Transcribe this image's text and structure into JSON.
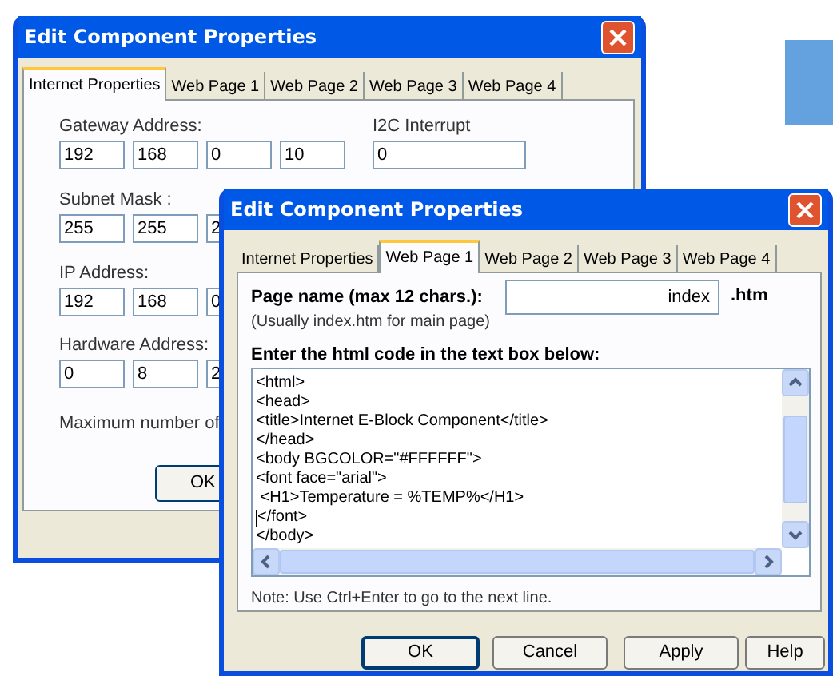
{
  "back_window": {
    "title": "Edit Component Properties",
    "tabs": [
      {
        "label": "Internet Properties",
        "selected": true
      },
      {
        "label": "Web Page 1",
        "selected": false
      },
      {
        "label": "Web Page 2",
        "selected": false
      },
      {
        "label": "Web Page 3",
        "selected": false
      },
      {
        "label": "Web Page 4",
        "selected": false
      }
    ],
    "address_groups": [
      {
        "label": "Gateway Address:",
        "values": [
          "192",
          "168",
          "0",
          "10"
        ]
      },
      {
        "label": "Subnet Mask :",
        "values": [
          "255",
          "255",
          "2"
        ]
      },
      {
        "label": "IP Address:",
        "values": [
          "192",
          "168",
          "0"
        ]
      },
      {
        "label": "Hardware Address:",
        "values": [
          "0",
          "8",
          "2"
        ]
      }
    ],
    "i2c": {
      "label": "I2C Interrupt",
      "value": "0"
    },
    "note": "Maximum number of",
    "buttons": [
      "OK"
    ]
  },
  "front_window": {
    "title": "Edit Component Properties",
    "tabs": [
      {
        "label": "Internet Properties",
        "selected": false
      },
      {
        "label": "Web Page 1",
        "selected": true
      },
      {
        "label": "Web Page 2",
        "selected": false
      },
      {
        "label": "Web Page 3",
        "selected": false
      },
      {
        "label": "Web Page 4",
        "selected": false
      }
    ],
    "page_name": {
      "label": "Page name (max 12 chars.):",
      "hint": "(Usually index.htm for main page)",
      "value": "index",
      "suffix": ".htm"
    },
    "code_label": "Enter the html code in the text box below:",
    "code_lines": [
      {
        "text": "<html>",
        "caret": false
      },
      {
        "text": "<head>",
        "caret": false
      },
      {
        "text": "<title>Internet E-Block Component</title>",
        "caret": false
      },
      {
        "text": "</head>",
        "caret": false
      },
      {
        "text": "<body BGCOLOR=\"#FFFFFF\">",
        "caret": false
      },
      {
        "text": "<font face=\"arial\">",
        "caret": false
      },
      {
        "text": " <H1>Temperature = %TEMP%</H1>",
        "caret": false
      },
      {
        "text": "</font>",
        "caret": true
      },
      {
        "text": "</body>",
        "caret": false
      }
    ],
    "note": "Note: Use Ctrl+Enter to go to the next line.",
    "buttons": [
      "OK",
      "Cancel",
      "Apply",
      "Help"
    ]
  }
}
